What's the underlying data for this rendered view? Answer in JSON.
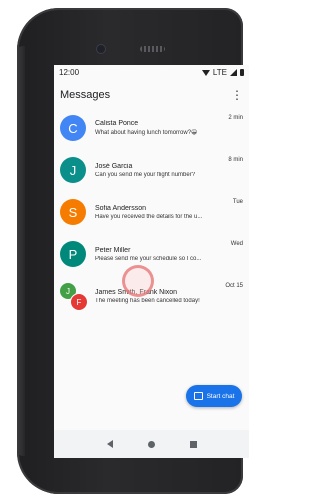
{
  "status_bar": {
    "time": "12:00",
    "network": "LTE"
  },
  "app_bar": {
    "title": "Messages",
    "menu_icon": "more-vert-icon"
  },
  "conversations": [
    {
      "initial": "C",
      "name": "Calista Ponce",
      "message": "What about having lunch tomorrow?😀",
      "time": "2 min",
      "color": "#4285f4"
    },
    {
      "initial": "J",
      "name": "José Garcia",
      "message": "Can you send me your flight number?",
      "time": "8 min",
      "color": "#0b8f8a"
    },
    {
      "initial": "S",
      "name": "Sofia Andersson",
      "message": "Have you received the details for the u...",
      "time": "Tue",
      "color": "#f57c00"
    },
    {
      "initial": "P",
      "name": "Peter Miller",
      "message": "Please send me your schedule so I co...",
      "time": "Wed",
      "color": "#00897b"
    },
    {
      "initial_1": "J",
      "initial_2": "F",
      "name": "James Smith, Frank Nixon",
      "message": "The meeting has been cancelled today!",
      "time": "Oct 15",
      "color_1": "#43a047",
      "color_2": "#e53935"
    }
  ],
  "fab": {
    "label": "Start chat",
    "icon": "chat-icon"
  },
  "nav": {
    "back_icon": "back-icon",
    "home_icon": "home-icon",
    "recents_icon": "recents-icon"
  },
  "colors": {
    "accent": "#1a73e8",
    "background": "#fafafa"
  }
}
